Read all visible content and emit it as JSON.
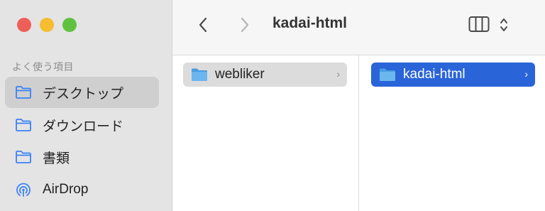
{
  "window": {
    "title": "kadai-html"
  },
  "sidebar": {
    "section_title": "よく使う項目",
    "items": [
      {
        "label": "デスクトップ",
        "icon": "folder-icon",
        "selected": true
      },
      {
        "label": "ダウンロード",
        "icon": "folder-icon",
        "selected": false
      },
      {
        "label": "書類",
        "icon": "folder-icon",
        "selected": false
      },
      {
        "label": "AirDrop",
        "icon": "airdrop-icon",
        "selected": false
      }
    ]
  },
  "columns": [
    {
      "items": [
        {
          "label": "webliker",
          "icon": "folder-icon",
          "state": "parent-selected"
        }
      ]
    },
    {
      "items": [
        {
          "label": "kadai-html",
          "icon": "folder-icon",
          "state": "selected"
        }
      ]
    }
  ],
  "colors": {
    "accent": "#2964d9",
    "sidebar_icon": "#3a82f6",
    "folder": "#6cb6ee"
  }
}
